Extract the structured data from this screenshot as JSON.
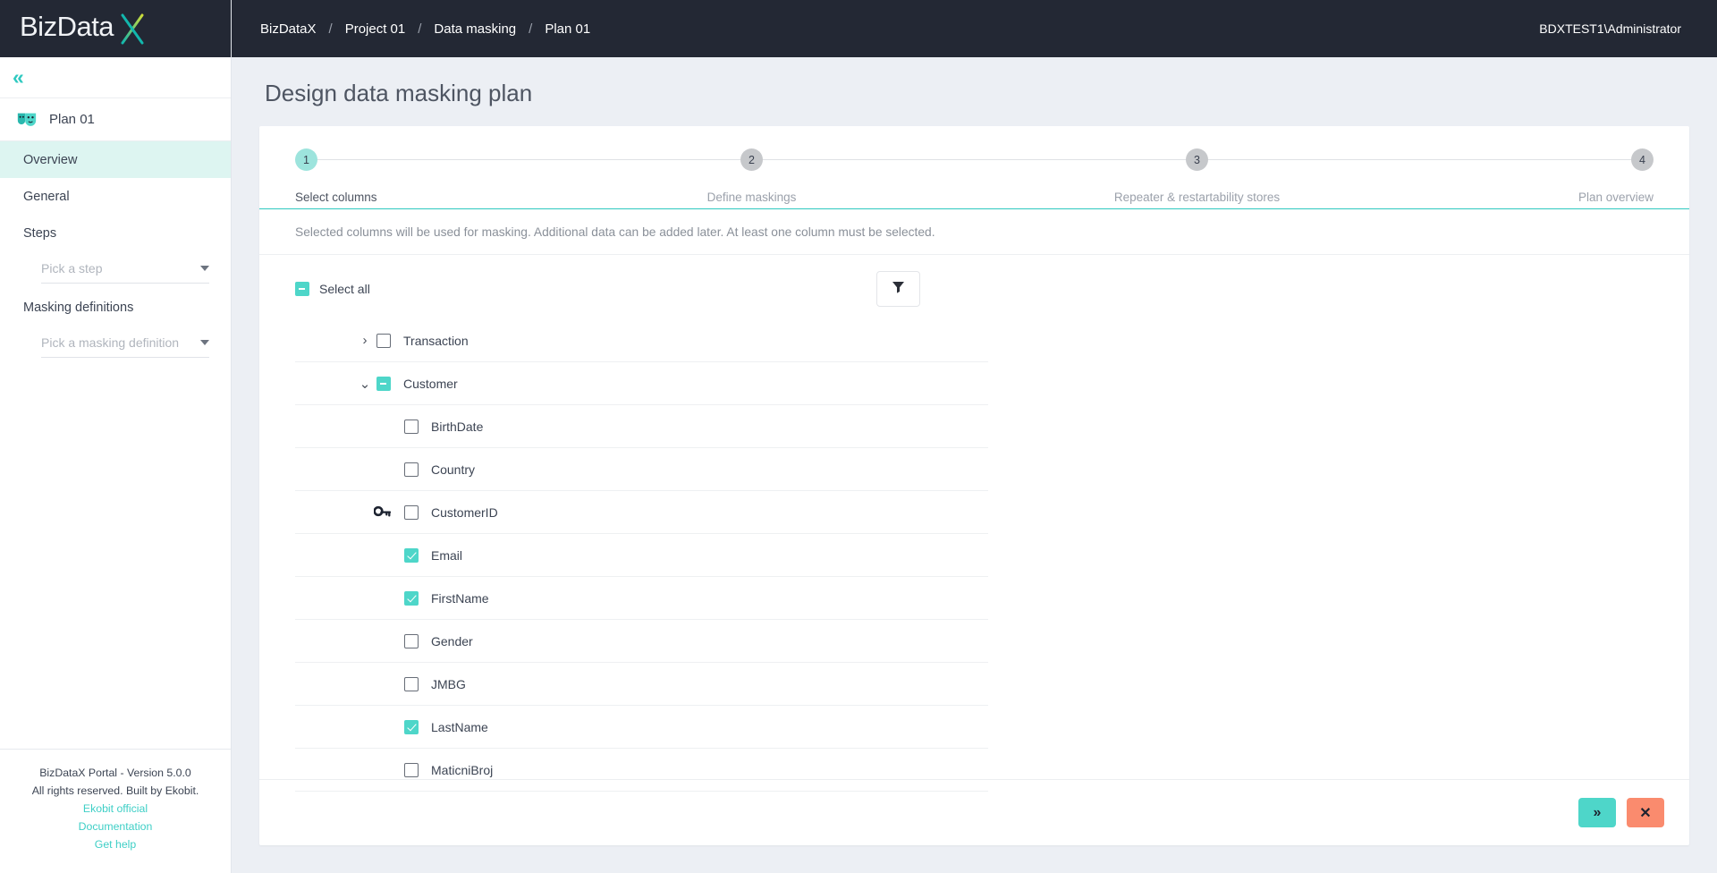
{
  "brand": {
    "name": "BizDataX",
    "logo_text": "BizData",
    "logo_accent": "X",
    "accent_color": "#2fc9c0",
    "dark_color": "#232834"
  },
  "sidebar": {
    "collapse_icon": "chevrons-left-icon",
    "plan": {
      "icon": "masks-icon",
      "label": "Plan 01"
    },
    "items": [
      {
        "label": "Overview",
        "active": true
      },
      {
        "label": "General",
        "active": false
      }
    ],
    "steps_section": {
      "label": "Steps",
      "picker_placeholder": "Pick a step"
    },
    "masking_section": {
      "label": "Masking definitions",
      "picker_placeholder": "Pick a masking definition"
    },
    "footer": {
      "version": "BizDataX Portal - Version 5.0.0",
      "rights": "All rights reserved. Built by Ekobit.",
      "links": [
        "Ekobit official",
        "Documentation",
        "Get help"
      ]
    }
  },
  "topbar": {
    "breadcrumbs": [
      "BizDataX",
      "Project 01",
      "Data masking",
      "Plan 01"
    ],
    "separator": "/",
    "user": "BDXTEST1\\Administrator"
  },
  "page": {
    "title": "Design data masking plan"
  },
  "stepper": {
    "steps": [
      {
        "number": "1",
        "label": "Select columns",
        "active": true
      },
      {
        "number": "2",
        "label": "Define maskings",
        "active": false
      },
      {
        "number": "3",
        "label": "Repeater & restartability stores",
        "active": false
      },
      {
        "number": "4",
        "label": "Plan overview",
        "active": false
      }
    ]
  },
  "info": {
    "text": "Selected columns will be used for masking. Additional data can be added later. At least one column must be selected."
  },
  "tree": {
    "select_all_label": "Select all",
    "select_all_state": "indeterminate",
    "filter_icon": "filter-icon",
    "tables": [
      {
        "name": "Transaction",
        "expanded": false,
        "chevron": "chevron-right-icon",
        "checkbox_state": "unchecked",
        "columns": []
      },
      {
        "name": "Customer",
        "expanded": true,
        "chevron": "chevron-down-icon",
        "checkbox_state": "indeterminate",
        "columns": [
          {
            "name": "BirthDate",
            "checkbox_state": "unchecked",
            "primary_key": false
          },
          {
            "name": "Country",
            "checkbox_state": "unchecked",
            "primary_key": false
          },
          {
            "name": "CustomerID",
            "checkbox_state": "unchecked",
            "primary_key": true
          },
          {
            "name": "Email",
            "checkbox_state": "checked",
            "primary_key": false
          },
          {
            "name": "FirstName",
            "checkbox_state": "checked",
            "primary_key": false
          },
          {
            "name": "Gender",
            "checkbox_state": "unchecked",
            "primary_key": false
          },
          {
            "name": "JMBG",
            "checkbox_state": "unchecked",
            "primary_key": false
          },
          {
            "name": "LastName",
            "checkbox_state": "checked",
            "primary_key": false
          },
          {
            "name": "MaticniBroj",
            "checkbox_state": "unchecked",
            "primary_key": false
          }
        ]
      }
    ]
  },
  "actions": {
    "next_label": "»",
    "next_name": "next-button",
    "cancel_label": "✕",
    "cancel_name": "cancel-button",
    "next_color": "#4ed6c9",
    "cancel_color": "#fa8b6e"
  }
}
